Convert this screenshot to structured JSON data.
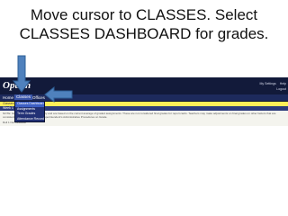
{
  "slide": {
    "title_line1": "Move cursor to CLASSES. Select",
    "title_line2": "CLASSES DASHBOARD for grades."
  },
  "app": {
    "logo": "Option",
    "util_links": [
      "My Settings",
      "Help"
    ],
    "logout": "Logout",
    "nav": [
      "Home",
      "Classes",
      "Offices"
    ],
    "active_nav": "Classes",
    "dropdown": [
      "Classes Dashboard",
      "Assignments",
      "Term Grades",
      "Attendance Records"
    ],
    "band_label": "Classes",
    "year_label": "Week 1",
    "note": "NOTE: Grades are informational only and are based on the current average of graded assignments. These are not considered final grades for report cards. Teachers may make adjustments on final grades on other factors that are consistent with Board Policy and Superintendent's Administrative Procedures on Grade.",
    "note2": "Roll 1 Not Available"
  },
  "colors": {
    "arrow": "#4f81bd",
    "header": "#121a3a",
    "band": "#ffee58"
  }
}
